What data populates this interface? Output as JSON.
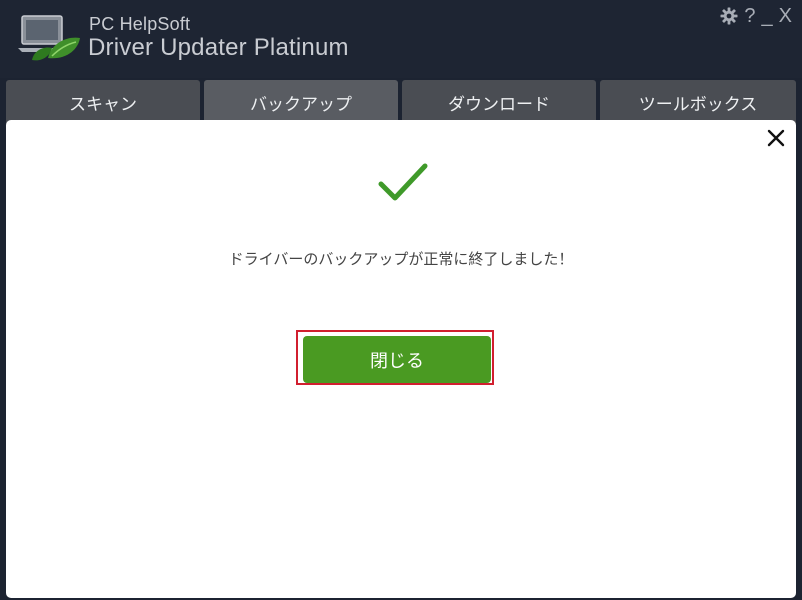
{
  "app": {
    "brand_small": "PC HelpSoft",
    "brand_large": "Driver Updater Platinum",
    "logo_icon": "laptop-leaf-icon"
  },
  "window_controls": {
    "settings_icon": "gear-icon",
    "help_label": "?",
    "minimize_label": "_",
    "close_label": "X"
  },
  "tabs": [
    {
      "label": "スキャン",
      "active": false
    },
    {
      "label": "バックアップ",
      "active": true
    },
    {
      "label": "ダウンロード",
      "active": false
    },
    {
      "label": "ツールボックス",
      "active": false
    }
  ],
  "dialog": {
    "close_icon": "close-icon",
    "status_icon": "checkmark-icon",
    "message": "ドライバーのバックアップが正常に終了しました！",
    "button_label": "閉じる"
  },
  "colors": {
    "accent_green": "#4a9a22",
    "check_green": "#3f9a2a",
    "focus_red": "#d11f2f",
    "titlebar": "#1e2533",
    "tab": "#4a4d53"
  }
}
